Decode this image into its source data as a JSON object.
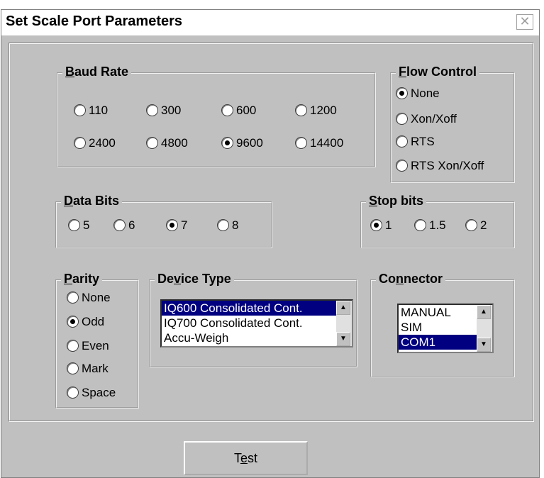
{
  "window": {
    "title": "Set Scale Port Parameters",
    "close_glyph": "✕"
  },
  "baud_rate": {
    "label_prefix": "B",
    "label_rest": "aud Rate",
    "options": [
      "110",
      "300",
      "600",
      "1200",
      "2400",
      "4800",
      "9600",
      "14400"
    ],
    "selected": "9600"
  },
  "flow_control": {
    "label_prefix": "F",
    "label_rest": "low Control",
    "options": [
      "None",
      "Xon/Xoff",
      "RTS",
      "RTS Xon/Xoff"
    ],
    "selected": "None"
  },
  "data_bits": {
    "label_prefix": "D",
    "label_rest": "ata Bits",
    "options": [
      "5",
      "6",
      "7",
      "8"
    ],
    "selected": "7"
  },
  "stop_bits": {
    "label_prefix": "S",
    "label_rest": "top bits",
    "options": [
      "1",
      "1.5",
      "2"
    ],
    "selected": "1"
  },
  "parity": {
    "label_a": "P",
    "label_b": "arity",
    "options": [
      "None",
      "Odd",
      "Even",
      "Mark",
      "Space"
    ],
    "selected": "Odd"
  },
  "device_type": {
    "label_a": "De",
    "label_u": "v",
    "label_b": "ice Type",
    "items": [
      "IQ600 Consolidated Cont.",
      "IQ700 Consolidated Cont.",
      "Accu-Weigh"
    ],
    "selected": "IQ600 Consolidated Cont."
  },
  "connector": {
    "label_a": "Co",
    "label_u": "n",
    "label_b": "nector",
    "items": [
      "MANUAL",
      "SIM",
      "COM1"
    ],
    "selected": "COM1"
  },
  "test_button": {
    "label_a": "T",
    "label_u": "e",
    "label_b": "st"
  }
}
